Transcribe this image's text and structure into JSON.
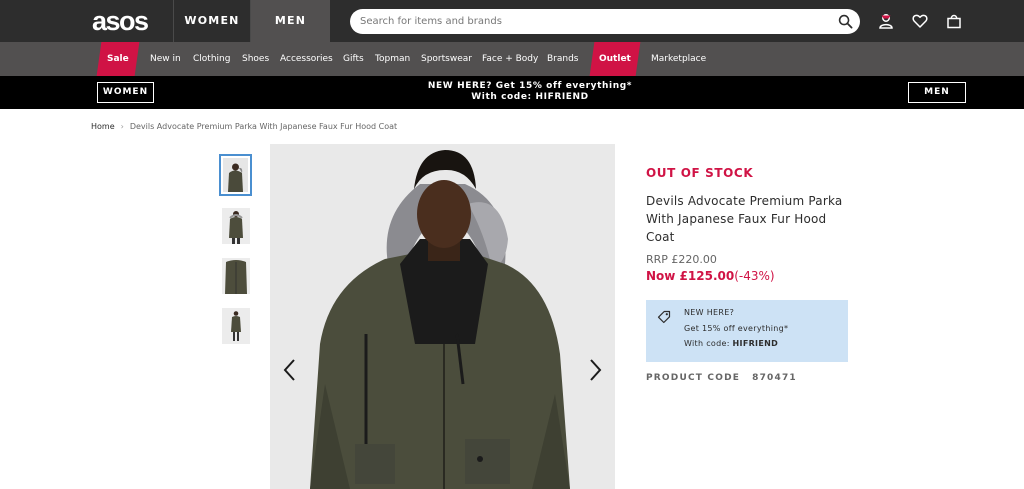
{
  "header": {
    "logo": "asos",
    "tabs": [
      "WOMEN",
      "MEN"
    ],
    "search_placeholder": "Search for items and brands"
  },
  "nav": {
    "items": [
      "Sale",
      "New in",
      "Clothing",
      "Shoes",
      "Accessories",
      "Gifts",
      "Topman",
      "Sportswear",
      "Face + Body",
      "Brands",
      "Outlet",
      "Marketplace"
    ]
  },
  "promo": {
    "women": "WOMEN",
    "men": "MEN",
    "line1": "NEW HERE? Get 15% off everything*",
    "line2": "With code: HIFRIEND"
  },
  "breadcrumb": {
    "home": "Home",
    "separator": "›",
    "current": "Devils Advocate Premium Parka With Japanese Faux Fur Hood Coat"
  },
  "product": {
    "status": "OUT OF STOCK",
    "title": "Devils Advocate Premium Parka With Japanese Faux Fur Hood Coat",
    "rrp": "RRP £220.00",
    "now_label": "Now £125.00",
    "discount": "(-43%)",
    "promo_title": "NEW HERE?",
    "promo_offer": "Get 15% off everything*",
    "promo_code_label": "With code: ",
    "promo_code": "HIFRIEND",
    "code_label": "PRODUCT CODE",
    "code": "870471"
  },
  "colors": {
    "header_bg": "#2d2d2d",
    "nav_bg": "#525050",
    "sale_red": "#d01345",
    "promo_box": "#cde2f5",
    "thumb_border": "#4a8fd0"
  }
}
